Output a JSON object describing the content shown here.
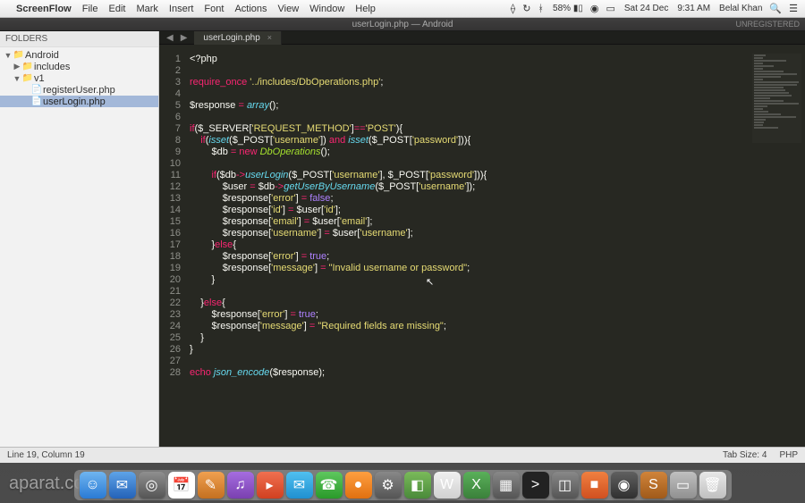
{
  "menubar": {
    "app": "ScreenFlow",
    "items": [
      "File",
      "Edit",
      "Mark",
      "Insert",
      "Font",
      "Actions",
      "View",
      "Window",
      "Help"
    ],
    "battery": "58%",
    "date": "Sat 24 Dec",
    "time": "9:31 AM",
    "user": "Belal Khan"
  },
  "window": {
    "title": "userLogin.php — Android",
    "unregistered": "UNREGISTERED"
  },
  "sidebar": {
    "header": "FOLDERS",
    "tree": [
      {
        "type": "folder",
        "label": "Android",
        "indent": 0,
        "open": true
      },
      {
        "type": "folder",
        "label": "includes",
        "indent": 1,
        "open": false
      },
      {
        "type": "folder",
        "label": "v1",
        "indent": 1,
        "open": true
      },
      {
        "type": "file",
        "label": "registerUser.php",
        "indent": 2
      },
      {
        "type": "file",
        "label": "userLogin.php",
        "indent": 2,
        "selected": true
      }
    ]
  },
  "tab": {
    "name": "userLogin.php"
  },
  "code": {
    "lines": [
      [
        [
          "tag",
          "<?php"
        ]
      ],
      [],
      [
        [
          "kw",
          "require_once"
        ],
        [
          "tag",
          " "
        ],
        [
          "str",
          "'../includes/DbOperations.php'"
        ],
        [
          "tag",
          ";"
        ]
      ],
      [],
      [
        [
          "var",
          "$response "
        ],
        [
          "op",
          "="
        ],
        [
          "tag",
          " "
        ],
        [
          "fn",
          "array"
        ],
        [
          "tag",
          "();"
        ]
      ],
      [],
      [
        [
          "kw",
          "if"
        ],
        [
          "tag",
          "("
        ],
        [
          "var",
          "$_SERVER"
        ],
        [
          "tag",
          "["
        ],
        [
          "str",
          "'REQUEST_METHOD'"
        ],
        [
          "tag",
          "]"
        ],
        [
          "op",
          "=="
        ],
        [
          "str",
          "'POST'"
        ],
        [
          "tag",
          "){"
        ]
      ],
      [
        [
          "tag",
          "    "
        ],
        [
          "kw",
          "if"
        ],
        [
          "tag",
          "("
        ],
        [
          "fn",
          "isset"
        ],
        [
          "tag",
          "("
        ],
        [
          "var",
          "$_POST"
        ],
        [
          "tag",
          "["
        ],
        [
          "str",
          "'username'"
        ],
        [
          "tag",
          "]) "
        ],
        [
          "op",
          "and"
        ],
        [
          "tag",
          " "
        ],
        [
          "fn",
          "isset"
        ],
        [
          "tag",
          "("
        ],
        [
          "var",
          "$_POST"
        ],
        [
          "tag",
          "["
        ],
        [
          "str",
          "'password'"
        ],
        [
          "tag",
          "])){"
        ]
      ],
      [
        [
          "tag",
          "        "
        ],
        [
          "var",
          "$db "
        ],
        [
          "op",
          "= new"
        ],
        [
          "tag",
          " "
        ],
        [
          "cls",
          "DbOperations"
        ],
        [
          "tag",
          "();"
        ]
      ],
      [],
      [
        [
          "tag",
          "        "
        ],
        [
          "kw",
          "if"
        ],
        [
          "tag",
          "("
        ],
        [
          "var",
          "$db"
        ],
        [
          "op",
          "->"
        ],
        [
          "fn",
          "userLogin"
        ],
        [
          "tag",
          "("
        ],
        [
          "var",
          "$_POST"
        ],
        [
          "tag",
          "["
        ],
        [
          "str",
          "'username'"
        ],
        [
          "tag",
          "], "
        ],
        [
          "var",
          "$_POST"
        ],
        [
          "tag",
          "["
        ],
        [
          "str",
          "'password'"
        ],
        [
          "tag",
          "])){"
        ]
      ],
      [
        [
          "tag",
          "            "
        ],
        [
          "var",
          "$user "
        ],
        [
          "op",
          "="
        ],
        [
          "tag",
          " "
        ],
        [
          "var",
          "$db"
        ],
        [
          "op",
          "->"
        ],
        [
          "fn",
          "getUserByUsername"
        ],
        [
          "tag",
          "("
        ],
        [
          "var",
          "$_POST"
        ],
        [
          "tag",
          "["
        ],
        [
          "str",
          "'username'"
        ],
        [
          "tag",
          "]);"
        ]
      ],
      [
        [
          "tag",
          "            "
        ],
        [
          "var",
          "$response"
        ],
        [
          "tag",
          "["
        ],
        [
          "str",
          "'error'"
        ],
        [
          "tag",
          "] "
        ],
        [
          "op",
          "="
        ],
        [
          "tag",
          " "
        ],
        [
          "const",
          "false"
        ],
        [
          "tag",
          ";"
        ]
      ],
      [
        [
          "tag",
          "            "
        ],
        [
          "var",
          "$response"
        ],
        [
          "tag",
          "["
        ],
        [
          "str",
          "'id'"
        ],
        [
          "tag",
          "] "
        ],
        [
          "op",
          "="
        ],
        [
          "tag",
          " "
        ],
        [
          "var",
          "$user"
        ],
        [
          "tag",
          "["
        ],
        [
          "str",
          "'id'"
        ],
        [
          "tag",
          "];"
        ]
      ],
      [
        [
          "tag",
          "            "
        ],
        [
          "var",
          "$response"
        ],
        [
          "tag",
          "["
        ],
        [
          "str",
          "'email'"
        ],
        [
          "tag",
          "] "
        ],
        [
          "op",
          "="
        ],
        [
          "tag",
          " "
        ],
        [
          "var",
          "$user"
        ],
        [
          "tag",
          "["
        ],
        [
          "str",
          "'email'"
        ],
        [
          "tag",
          "];"
        ]
      ],
      [
        [
          "tag",
          "            "
        ],
        [
          "var",
          "$response"
        ],
        [
          "tag",
          "["
        ],
        [
          "str",
          "'username'"
        ],
        [
          "tag",
          "] "
        ],
        [
          "op",
          "="
        ],
        [
          "tag",
          " "
        ],
        [
          "var",
          "$user"
        ],
        [
          "tag",
          "["
        ],
        [
          "str",
          "'username'"
        ],
        [
          "tag",
          "];"
        ]
      ],
      [
        [
          "tag",
          "        }"
        ],
        [
          "kw",
          "else"
        ],
        [
          "tag",
          "{"
        ]
      ],
      [
        [
          "tag",
          "            "
        ],
        [
          "var",
          "$response"
        ],
        [
          "tag",
          "["
        ],
        [
          "str",
          "'error'"
        ],
        [
          "tag",
          "] "
        ],
        [
          "op",
          "="
        ],
        [
          "tag",
          " "
        ],
        [
          "const",
          "true"
        ],
        [
          "tag",
          ";"
        ]
      ],
      [
        [
          "tag",
          "            "
        ],
        [
          "var",
          "$response"
        ],
        [
          "tag",
          "["
        ],
        [
          "str",
          "'message'"
        ],
        [
          "tag",
          "] "
        ],
        [
          "op",
          "="
        ],
        [
          "tag",
          " "
        ],
        [
          "str",
          "\"Invalid username or password\""
        ],
        [
          "tag",
          ";"
        ]
      ],
      [
        [
          "tag",
          "        }"
        ]
      ],
      [],
      [
        [
          "tag",
          "    }"
        ],
        [
          "kw",
          "else"
        ],
        [
          "tag",
          "{"
        ]
      ],
      [
        [
          "tag",
          "        "
        ],
        [
          "var",
          "$response"
        ],
        [
          "tag",
          "["
        ],
        [
          "str",
          "'error'"
        ],
        [
          "tag",
          "] "
        ],
        [
          "op",
          "="
        ],
        [
          "tag",
          " "
        ],
        [
          "const",
          "true"
        ],
        [
          "tag",
          ";"
        ]
      ],
      [
        [
          "tag",
          "        "
        ],
        [
          "var",
          "$response"
        ],
        [
          "tag",
          "["
        ],
        [
          "str",
          "'message'"
        ],
        [
          "tag",
          "] "
        ],
        [
          "op",
          "="
        ],
        [
          "tag",
          " "
        ],
        [
          "str",
          "\"Required fields are missing\""
        ],
        [
          "tag",
          ";"
        ]
      ],
      [
        [
          "tag",
          "    }"
        ]
      ],
      [
        [
          "tag",
          "}"
        ]
      ],
      [],
      [
        [
          "kw",
          "echo"
        ],
        [
          "tag",
          " "
        ],
        [
          "fn",
          "json_encode"
        ],
        [
          "tag",
          "("
        ],
        [
          "var",
          "$response"
        ],
        [
          "tag",
          ");"
        ]
      ]
    ]
  },
  "statusbar": {
    "position": "Line 19, Column 19",
    "tabsize": "Tab Size: 4",
    "lang": "PHP"
  },
  "dock": {
    "icons": [
      {
        "bg": "linear-gradient(#6fb5f0,#2a7ad4)",
        "char": "☺"
      },
      {
        "bg": "linear-gradient(#5ea3e8,#2462b8)",
        "char": "✉"
      },
      {
        "bg": "linear-gradient(#8f8f8f,#555)",
        "char": "◎"
      },
      {
        "bg": "#fff",
        "char": "📅"
      },
      {
        "bg": "linear-gradient(#f0a050,#c47020)",
        "char": "✎"
      },
      {
        "bg": "linear-gradient(#a56de0,#7a40b0)",
        "char": "♫"
      },
      {
        "bg": "linear-gradient(#f07050,#d04020)",
        "char": "▸"
      },
      {
        "bg": "linear-gradient(#50c0f0,#2090d0)",
        "char": "✉"
      },
      {
        "bg": "linear-gradient(#5ec75e,#2a9a2a)",
        "char": "☎"
      },
      {
        "bg": "linear-gradient(#ff9f40,#e07010)",
        "char": "●"
      },
      {
        "bg": "linear-gradient(#888,#555)",
        "char": "⚙"
      },
      {
        "bg": "linear-gradient(#7aba5a,#4a8a3a)",
        "char": "◧"
      },
      {
        "bg": "linear-gradient(#f0f0f0,#d0d0d0)",
        "char": "W"
      },
      {
        "bg": "linear-gradient(#5ab05a,#3a803a)",
        "char": "X"
      },
      {
        "bg": "linear-gradient(#888,#555)",
        "char": "▦"
      },
      {
        "bg": "#222",
        "char": ">"
      },
      {
        "bg": "linear-gradient(#888,#555)",
        "char": "◫"
      },
      {
        "bg": "linear-gradient(#f08040,#d05020)",
        "char": "■"
      },
      {
        "bg": "linear-gradient(#606060,#303030)",
        "char": "◉"
      },
      {
        "bg": "linear-gradient(#d0843a,#a05a1a)",
        "char": "S"
      },
      {
        "bg": "linear-gradient(#c0c0c0,#909090)",
        "char": "▭"
      },
      {
        "bg": "linear-gradient(#e8e8e8,#c0c0c0)",
        "char": "🗑"
      }
    ]
  },
  "watermark": "aparat.com/koochaktarha"
}
